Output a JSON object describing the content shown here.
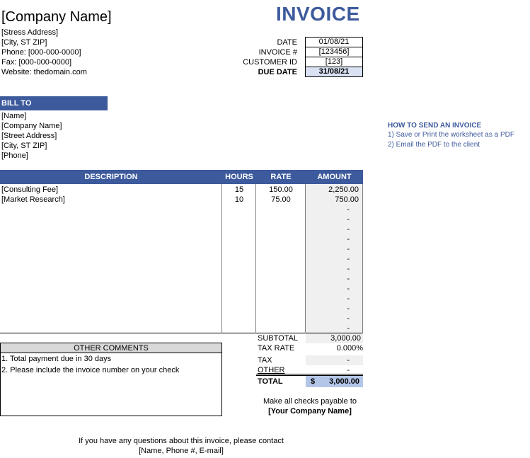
{
  "header": {
    "company_name": "[Company Name]",
    "title": "INVOICE",
    "address_lines": [
      "[Stress Address]",
      "[City, ST  ZIP]",
      "Phone: [000-000-0000]",
      "Fax: [000-000-0000]",
      "Website: thedomain.com"
    ]
  },
  "meta": {
    "date_label": "DATE",
    "date_value": "01/08/21",
    "invoice_label": "INVOICE #",
    "invoice_value": "[123456]",
    "customer_label": "CUSTOMER ID",
    "customer_value": "[123]",
    "due_label": "DUE DATE",
    "due_value": "31/08/21"
  },
  "bill_to": {
    "heading": "BILL TO",
    "lines": [
      "[Name]",
      "[Company Name]",
      "[Street Address]",
      "[City, ST  ZIP]",
      "[Phone]"
    ]
  },
  "howto": {
    "title": "HOW TO SEND AN INVOICE",
    "steps": [
      "1) Save or Print the worksheet as a PDF",
      "2) Email the PDF to the client"
    ]
  },
  "table": {
    "headers": {
      "description": "DESCRIPTION",
      "hours": "HOURS",
      "rate": "RATE",
      "amount": "AMOUNT"
    },
    "rows": [
      {
        "description": "[Consulting Fee]",
        "hours": "15",
        "rate": "150.00",
        "amount": "2,250.00"
      },
      {
        "description": "[Market Research]",
        "hours": "10",
        "rate": "75.00",
        "amount": "750.00"
      }
    ],
    "empty_amount": "-"
  },
  "totals": {
    "subtotal_label": "SUBTOTAL",
    "subtotal_value": "3,000.00",
    "taxrate_label": "TAX RATE",
    "taxrate_value": "0.000%",
    "tax_label": "TAX",
    "tax_value": "-",
    "other_label": "OTHER",
    "other_value": "-",
    "total_label": "TOTAL",
    "total_currency": "$",
    "total_value": "3,000.00"
  },
  "comments": {
    "heading": "OTHER COMMENTS",
    "lines": [
      "1. Total payment due in 30 days",
      "2. Please include the invoice number on your check"
    ]
  },
  "payable": {
    "line1": "Make all checks payable to",
    "line2": "[Your Company Name]"
  },
  "footer": {
    "line1": "If you have any questions about this invoice, please contact",
    "line2": "[Name, Phone #, E-mail]"
  },
  "colors": {
    "accent": "#3d5a9c",
    "total_highlight": "#b4c6e7",
    "due_highlight": "#d9e1f2",
    "shade": "#f0f0f0"
  }
}
